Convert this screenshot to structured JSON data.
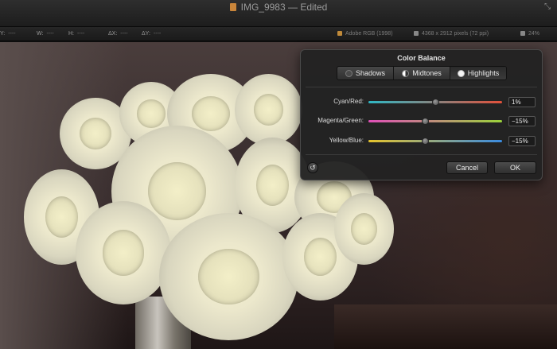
{
  "window": {
    "title": "IMG_9983 — Edited",
    "fullscreen_icon": "fullscreen-arrows-icon"
  },
  "infobar": {
    "x_label": "Y:",
    "x_value": "----",
    "w_label": "W:",
    "w_value": "----",
    "h_label": "H:",
    "h_value": "----",
    "dx_label": "ΔX:",
    "dx_value": "----",
    "dy_label": "ΔY:",
    "dy_value": "----",
    "color_profile": "Adobe RGB (1998)",
    "dimensions": "4368 x 2912 pixels (72 ppi)",
    "zoom": "24%"
  },
  "dialog": {
    "title": "Color Balance",
    "tabs": [
      {
        "label": "Shadows",
        "icon": "shadows-dot-icon",
        "active": false
      },
      {
        "label": "Midtones",
        "icon": "midtones-half-dot-icon",
        "active": false
      },
      {
        "label": "Highlights",
        "icon": "highlights-dot-icon",
        "active": true
      }
    ],
    "sliders": [
      {
        "label": "Cyan/Red:",
        "value": "1%",
        "level": 0.505,
        "from": "#2fb7c4",
        "to": "#e2503a"
      },
      {
        "label": "Magenta/Green:",
        "value": "−15%",
        "level": 0.425,
        "from": "#e04fb8",
        "to": "#9ad23a"
      },
      {
        "label": "Yellow/Blue:",
        "value": "−15%",
        "level": 0.425,
        "from": "#e6c42c",
        "to": "#3a8be0"
      }
    ],
    "reset_icon": "reset-arrow-icon",
    "cancel_label": "Cancel",
    "ok_label": "OK"
  }
}
